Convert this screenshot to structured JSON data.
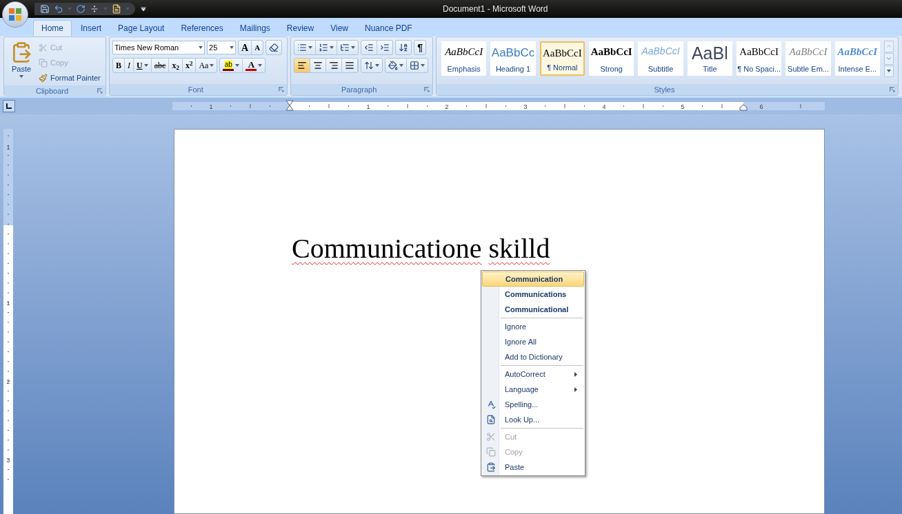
{
  "title_bar": {
    "title": "Document1  -  Microsoft Word"
  },
  "tabs": [
    {
      "label": "Home",
      "selected": true
    },
    {
      "label": "Insert",
      "selected": false
    },
    {
      "label": "Page Layout",
      "selected": false
    },
    {
      "label": "References",
      "selected": false
    },
    {
      "label": "Mailings",
      "selected": false
    },
    {
      "label": "Review",
      "selected": false
    },
    {
      "label": "View",
      "selected": false
    },
    {
      "label": "Nuance PDF",
      "selected": false
    }
  ],
  "clipboard": {
    "label": "Clipboard",
    "paste": "Paste",
    "items": [
      {
        "label": "Cut",
        "kind": "cut",
        "disabled": true
      },
      {
        "label": "Copy",
        "kind": "copy",
        "disabled": true
      },
      {
        "label": "Format Painter",
        "kind": "painter",
        "disabled": false
      }
    ]
  },
  "font": {
    "label": "Font",
    "font_name": "Times New Roman",
    "font_size": "25",
    "size_buttons": [
      {
        "glyph": "A",
        "kind": "grow"
      },
      {
        "glyph": "A",
        "kind": "shrink"
      }
    ],
    "format_buttons": [
      {
        "glyph": "B",
        "kind": "bold"
      },
      {
        "glyph": "I",
        "kind": "italic"
      },
      {
        "glyph": "U",
        "kind": "underline"
      },
      {
        "glyph": "abc",
        "kind": "strike"
      },
      {
        "glyph": "x$_{2}$",
        "kind": "sub"
      },
      {
        "glyph": "x$^{2}$",
        "kind": "sup"
      },
      {
        "glyph": "Aa",
        "kind": "case"
      }
    ],
    "color_buttons": [
      {
        "glyph": "ab",
        "kind": "highlight",
        "color": "#7f0000"
      },
      {
        "glyph": "A",
        "kind": "fontcolor",
        "color": "#c00000"
      }
    ]
  },
  "paragraph": {
    "label": "Paragraph",
    "show_marks": "¶",
    "alignments": [
      {
        "kind": "left",
        "selected": true
      },
      {
        "kind": "center",
        "selected": false
      },
      {
        "kind": "right",
        "selected": false
      },
      {
        "kind": "justify",
        "selected": false
      }
    ]
  },
  "styles": {
    "label": "Styles",
    "items": [
      {
        "sample": "AaBbCcI",
        "name": "Emphasis",
        "kind": "emphasis",
        "selected": false
      },
      {
        "sample": "AaBbCc",
        "name": "Heading 1",
        "kind": "heading",
        "selected": false
      },
      {
        "sample": "AaBbCcI",
        "name": "¶ Normal",
        "kind": "normal",
        "selected": true
      },
      {
        "sample": "AaBbCcI",
        "name": "Strong",
        "kind": "strong",
        "selected": false
      },
      {
        "sample": "AaBbCcI",
        "name": "Subtitle",
        "kind": "subtitle",
        "selected": false
      },
      {
        "sample": "AaBl",
        "name": "Title",
        "kind": "title",
        "selected": false
      },
      {
        "sample": "AaBbCcI",
        "name": "¶ No Spaci...",
        "kind": "normal",
        "selected": false
      },
      {
        "sample": "AaBbCcI",
        "name": "Subtle Em...",
        "kind": "subtle",
        "selected": false
      },
      {
        "sample": "AaBbCcI",
        "name": "Intense E...",
        "kind": "intense",
        "selected": false
      }
    ]
  },
  "rulers": {
    "horizontal": [
      "1",
      "1",
      "2",
      "3",
      "4",
      "5",
      "6"
    ],
    "vertical": [
      "1",
      "1",
      "2",
      "3"
    ]
  },
  "document": {
    "words": [
      {
        "text": "Communicatione",
        "misspelled": true
      },
      {
        "text": "skilld",
        "misspelled": true
      }
    ]
  },
  "context_menu": {
    "items": [
      {
        "kind": "suggestion",
        "label": "Communication",
        "selected": true,
        "disabled": false
      },
      {
        "kind": "suggestion",
        "label": "Communications",
        "selected": false,
        "disabled": false
      },
      {
        "kind": "suggestion",
        "label": "Communicational",
        "selected": false,
        "disabled": false
      },
      {
        "kind": "separator"
      },
      {
        "kind": "item",
        "label": "Ignore",
        "selected": false,
        "disabled": false
      },
      {
        "kind": "item",
        "label": "Ignore All",
        "selected": false,
        "disabled": false
      },
      {
        "kind": "item",
        "label": "Add to Dictionary",
        "selected": false,
        "disabled": false
      },
      {
        "kind": "separator"
      },
      {
        "kind": "submenu",
        "label": "AutoCorrect",
        "selected": false,
        "disabled": false
      },
      {
        "kind": "submenu",
        "label": "Language",
        "selected": false,
        "disabled": false
      },
      {
        "kind": "item",
        "label": "Spelling...",
        "selected": false,
        "disabled": false
      },
      {
        "kind": "item",
        "label": "Look Up...",
        "selected": false,
        "disabled": false
      },
      {
        "kind": "separator"
      },
      {
        "kind": "item",
        "label": "Cut",
        "selected": false,
        "disabled": true
      },
      {
        "kind": "item",
        "label": "Copy",
        "selected": false,
        "disabled": true
      },
      {
        "kind": "item",
        "label": "Paste",
        "selected": false,
        "disabled": false
      }
    ]
  }
}
